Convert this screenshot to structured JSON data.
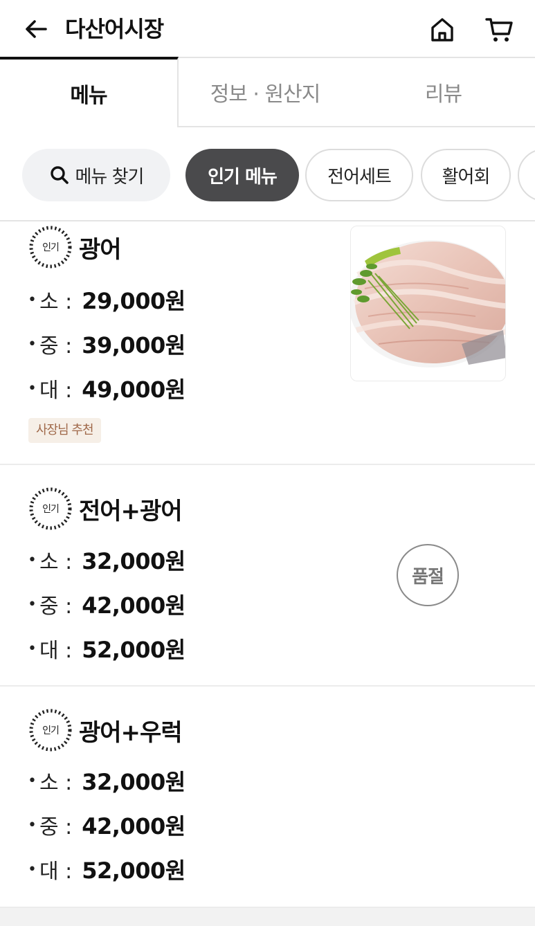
{
  "header": {
    "title": "다산어시장",
    "icons": {
      "back": "back-arrow-icon",
      "home": "home-icon",
      "cart": "cart-icon"
    }
  },
  "tabs": [
    {
      "label": "메뉴",
      "active": true
    },
    {
      "label": "정보 · 원산지",
      "active": false
    },
    {
      "label": "리뷰",
      "active": false
    }
  ],
  "chips": {
    "search_label": "메뉴 찾기",
    "items": [
      {
        "label": "인기 메뉴",
        "active": true
      },
      {
        "label": "전어세트",
        "active": false
      },
      {
        "label": "활어회",
        "active": false
      }
    ]
  },
  "badge_text": "인기",
  "menu_items": [
    {
      "name": "광어",
      "prices": [
        {
          "size": "소 :",
          "price": "29,000원"
        },
        {
          "size": "중 :",
          "price": "39,000원"
        },
        {
          "size": "대 :",
          "price": "49,000원"
        }
      ],
      "tag": "사장님 추천",
      "has_photo": true
    },
    {
      "name": "전어+광어",
      "prices": [
        {
          "size": "소 :",
          "price": "32,000원"
        },
        {
          "size": "중 :",
          "price": "42,000원"
        },
        {
          "size": "대 :",
          "price": "52,000원"
        }
      ],
      "status": "품절"
    },
    {
      "name": "광어+우럭",
      "prices": [
        {
          "size": "소 :",
          "price": "32,000원"
        },
        {
          "size": "중 :",
          "price": "42,000원"
        },
        {
          "size": "대 :",
          "price": "52,000원"
        }
      ]
    }
  ],
  "colors": {
    "active_chip_bg": "#4a4a4c",
    "tag_bg": "#f6efe7",
    "tag_text": "#a0694a",
    "soldout_border": "#8a8a8a"
  }
}
